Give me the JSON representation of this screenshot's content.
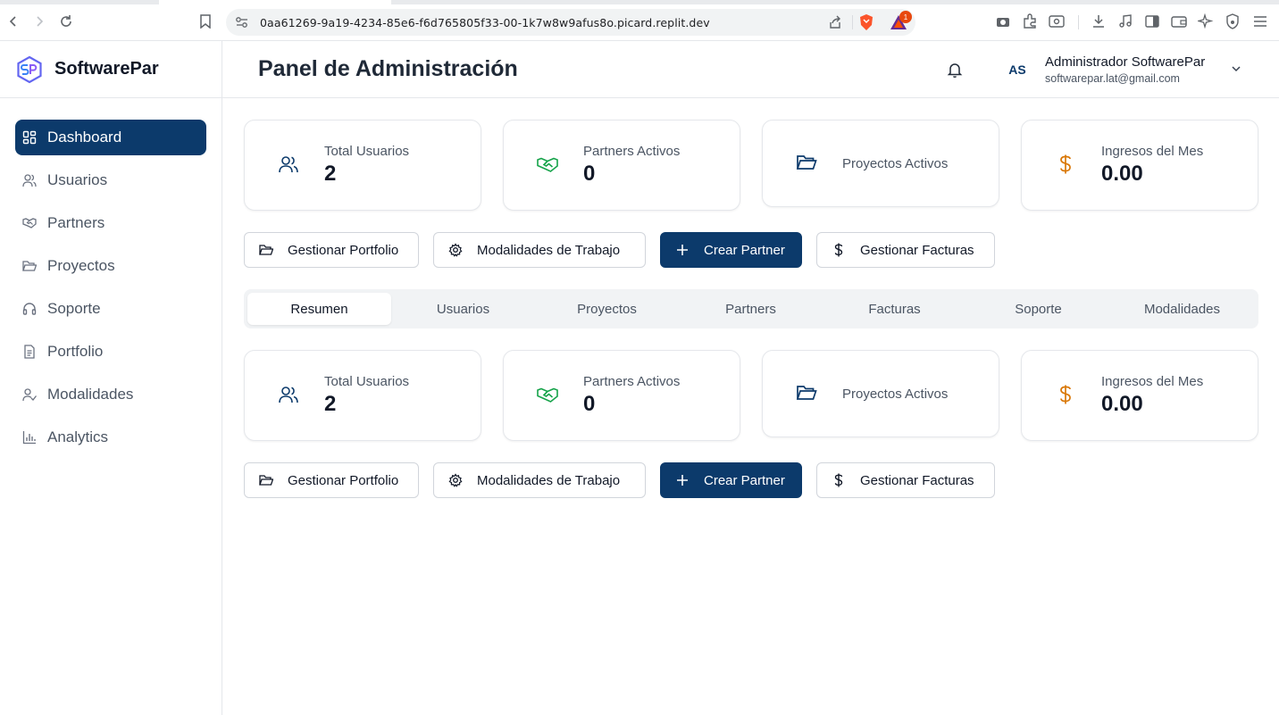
{
  "browser": {
    "url": "0aa61269-9a19-4234-85e6-f6d765805f33-00-1k7w8w9afus8o.picard.replit.dev",
    "notification_count": "1"
  },
  "brand": {
    "name": "SoftwarePar"
  },
  "sidebar": {
    "items": [
      {
        "label": "Dashboard",
        "icon": "dashboard-icon",
        "active": true
      },
      {
        "label": "Usuarios",
        "icon": "users-icon"
      },
      {
        "label": "Partners",
        "icon": "handshake-icon"
      },
      {
        "label": "Proyectos",
        "icon": "folder-icon"
      },
      {
        "label": "Soporte",
        "icon": "headset-icon"
      },
      {
        "label": "Portfolio",
        "icon": "document-icon"
      },
      {
        "label": "Modalidades",
        "icon": "user-check-icon"
      },
      {
        "label": "Analytics",
        "icon": "bar-chart-icon"
      }
    ]
  },
  "header": {
    "title": "Panel de Administración",
    "user": {
      "initials": "AS",
      "name": "Administrador SoftwarePar",
      "email": "softwarepar.lat@gmail.com"
    }
  },
  "stats": [
    {
      "label": "Total Usuarios",
      "value": "2",
      "icon": "users-icon",
      "color": "#0c3a6b"
    },
    {
      "label": "Partners Activos",
      "value": "0",
      "icon": "handshake-icon",
      "color": "#16a34a"
    },
    {
      "label": "Proyectos Activos",
      "value": "",
      "icon": "folder-icon",
      "color": "#0c3a6b"
    },
    {
      "label": "Ingresos del Mes",
      "value": "0.00",
      "icon": "dollar-icon",
      "color": "#d97706"
    }
  ],
  "actions": [
    {
      "label": "Gestionar Portfolio",
      "icon": "folder-icon"
    },
    {
      "label": "Modalidades de Trabajo",
      "icon": "gear-icon"
    },
    {
      "label": "Crear Partner",
      "icon": "plus-icon",
      "primary": true
    },
    {
      "label": "Gestionar Facturas",
      "icon": "dollar-icon"
    }
  ],
  "tabs": [
    {
      "label": "Resumen",
      "active": true
    },
    {
      "label": "Usuarios"
    },
    {
      "label": "Proyectos"
    },
    {
      "label": "Partners"
    },
    {
      "label": "Facturas"
    },
    {
      "label": "Soporte"
    },
    {
      "label": "Modalidades"
    }
  ],
  "colors": {
    "primary": "#0c3a6b",
    "success": "#16a34a",
    "warning": "#d97706"
  }
}
